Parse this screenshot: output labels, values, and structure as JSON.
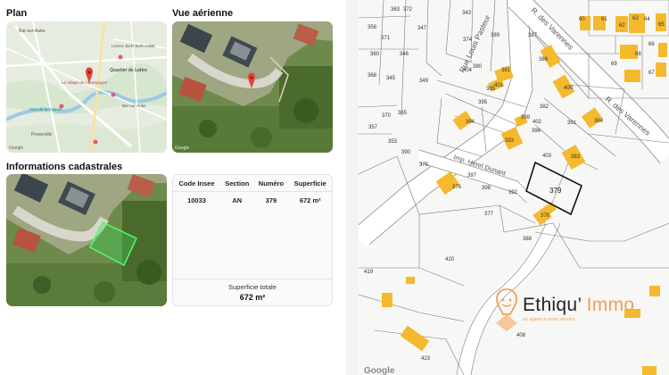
{
  "sections": {
    "plan": "Plan",
    "aerial": "Vue aérienne",
    "cadastral": "Informations cadastrales"
  },
  "plan_map": {
    "labels": [
      "Bar-sur-Aube",
      "Leclerc BAR SUR AUBE",
      "Quartier de Lattre",
      "Le village de Champagne",
      "Parc de la Grande",
      "Bar-sur-Aube",
      "Proverville",
      "Google"
    ]
  },
  "cadastre": {
    "headers": {
      "code": "Code Insee",
      "section": "Section",
      "numero": "Numéro",
      "superficie": "Superficie"
    },
    "rows": [
      {
        "code": "10033",
        "section": "AN",
        "numero": "379",
        "superficie": "672 m²"
      }
    ],
    "total_label": "Superficie totale",
    "total_value": "672 m²"
  },
  "parcel_map": {
    "selected": "379",
    "streets": [
      "Rue Louis Pasteur",
      "R. des Varennes",
      "R. des Varennes",
      "Imp. Henri Dunant"
    ],
    "parcels": [
      "363",
      "372",
      "343",
      "358",
      "371",
      "347",
      "374",
      "389",
      "387",
      "360",
      "346",
      "380",
      "381",
      "386",
      "368",
      "345",
      "349",
      "404",
      "401",
      "385",
      "400",
      "395",
      "394",
      "399",
      "402",
      "382",
      "384",
      "370",
      "365",
      "396",
      "391",
      "357",
      "353",
      "393",
      "403",
      "383",
      "390",
      "375",
      "397",
      "376",
      "398",
      "392",
      "379",
      "377",
      "378",
      "388",
      "419",
      "420",
      "408",
      "423",
      "60",
      "61",
      "62",
      "63",
      "64",
      "65",
      "69",
      "68",
      "66",
      "67"
    ],
    "google": "Google"
  },
  "brand": {
    "name_main": "Ethiqu’",
    "name_accent": "Immo",
    "tagline": "un agent à votre service"
  }
}
